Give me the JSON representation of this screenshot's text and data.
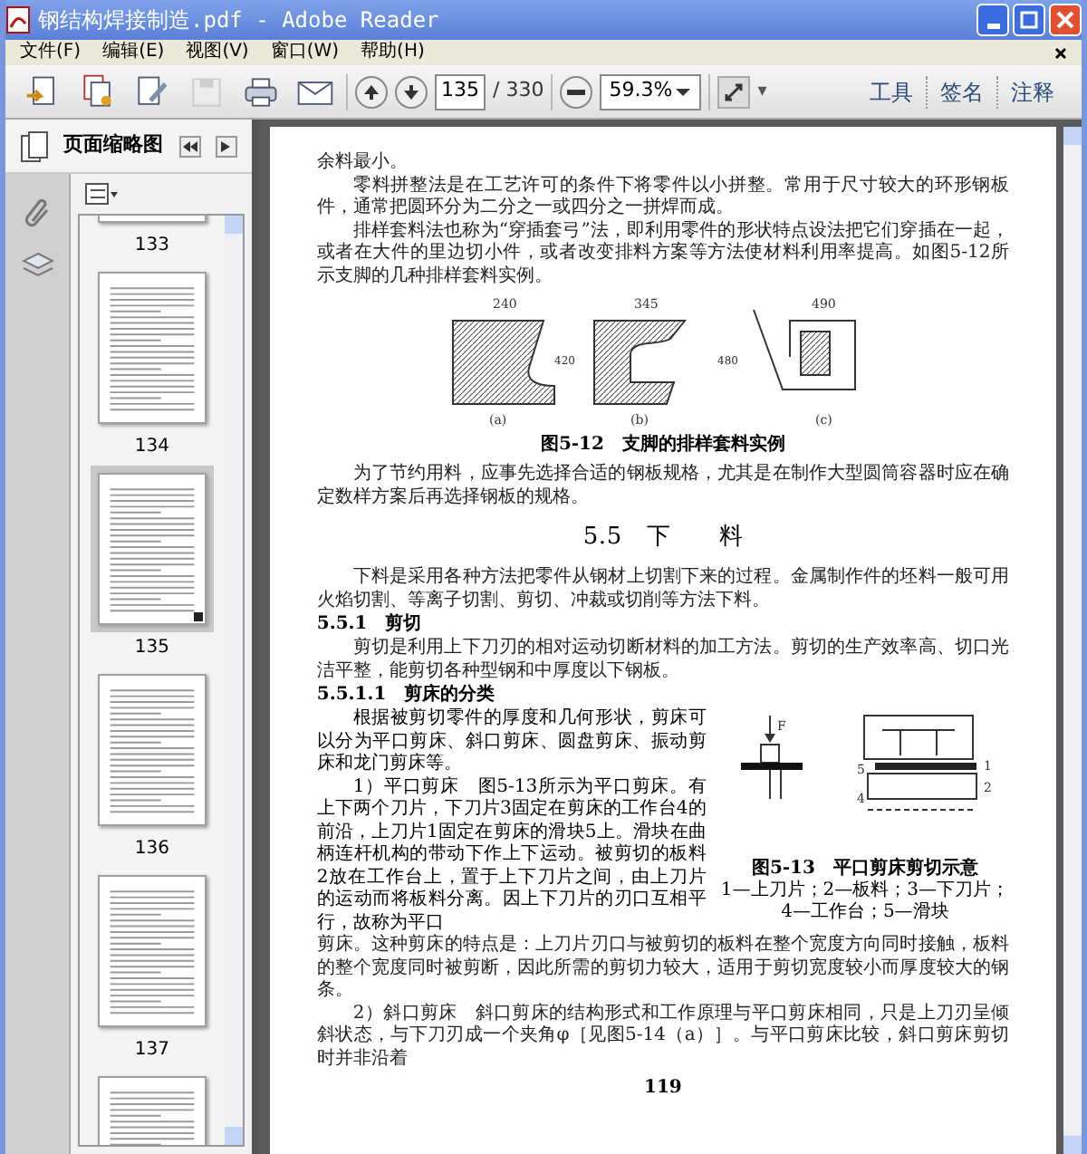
{
  "window": {
    "title": "钢结构焊接制造.pdf - Adobe Reader"
  },
  "menu": [
    {
      "label": "文件(F)"
    },
    {
      "label": "编辑(E)"
    },
    {
      "label": "视图(V)"
    },
    {
      "label": "窗口(W)"
    },
    {
      "label": "帮助(H)"
    }
  ],
  "toolbar": {
    "buttons": [
      {
        "kind": "create",
        "disabled": false
      },
      {
        "kind": "convert",
        "disabled": false
      },
      {
        "kind": "edit",
        "disabled": false
      },
      {
        "kind": "save",
        "disabled": true
      },
      {
        "kind": "print",
        "disabled": false
      },
      {
        "kind": "email",
        "disabled": false
      }
    ],
    "page_field": "135",
    "page_total": "/ 330",
    "zoom_field": "59.3%",
    "more": "▾",
    "panels": [
      {
        "label": "工具"
      },
      {
        "label": "签名"
      },
      {
        "label": "注释"
      }
    ]
  },
  "sidebar": {
    "title": "页面缩略图",
    "thumbnails": [
      {
        "label": "133",
        "selected": false
      },
      {
        "label": "134",
        "selected": false
      },
      {
        "label": "135",
        "selected": true
      },
      {
        "label": "136",
        "selected": false
      },
      {
        "label": "137",
        "selected": false
      },
      {
        "selected": false
      }
    ]
  },
  "document": {
    "blocks": [
      {
        "kind": "para",
        "text": "余料最小。",
        "indent": false
      },
      {
        "kind": "para",
        "text": "零料拼整法是在工艺许可的条件下将零件以小拼整。常用于尺寸较大的环形钢板件，通常把圆环分为二分之一或四分之一拼焊而成。",
        "indent": true
      },
      {
        "kind": "para",
        "text": "排样套料法也称为“穿插套弓”法，即利用零件的形状特点设法把它们穿插在一起，或者在大件的里边切小件，或者改变排料方案等方法使材料利用率提高。如图5-12所示支脚的几种排样套料实例。",
        "indent": true
      },
      {
        "kind": "figure",
        "dims": [
          "240",
          "345",
          "490"
        ],
        "heights": [
          "420",
          "480"
        ],
        "parts": [
          "(a)",
          "(b)",
          "(c)"
        ]
      },
      {
        "kind": "caption",
        "text": "图5-12　支脚的排样套料实例"
      },
      {
        "kind": "para",
        "text": "为了节约用料，应事先选择合适的钢板规格，尤其是在制作大型圆筒容器时应在确定数样方案后再选择钢板的规格。",
        "indent": true
      },
      {
        "kind": "section",
        "text": "5.5　下　　料"
      },
      {
        "kind": "para",
        "text": "下料是采用各种方法把零件从钢材上切割下来的过程。金属制作件的坯料一般可用火焰切割、等离子切割、剪切、冲裁或切削等方法下料。",
        "indent": true
      },
      {
        "kind": "subsection",
        "text": "5.5.1　剪切"
      },
      {
        "kind": "para",
        "text": "剪切是利用上下刀刃的相对运动切断材料的加工方法。剪切的生产效率高、切口光洁平整，能剪切各种型钢和中厚度以下钢板。",
        "indent": true
      },
      {
        "kind": "subsection",
        "text": "5.5.1.1　剪床的分类"
      },
      {
        "kind": "float",
        "paras": [
          "根据被剪切零件的厚度和几何形状，剪床可以分为平口剪床、斜口剪床、圆盘剪床、振动剪床和龙门剪床等。",
          "1）平口剪床　图5-13所示为平口剪床。有上下两个刀片，下刀片3固定在剪床的工作台4的前沿，上刀片1固定在剪床的滑块5上。滑块在曲柄连杆机构的带动下作上下运动。被剪切的板料2放在工作台上，置于上下刀片之间，由上刀片的运动而将板料分离。因上下刀片的刃口互相平行，故称为平口"
        ],
        "labels": [
          "F",
          "5",
          "1",
          "2",
          "4"
        ],
        "caption": "图5-13　平口剪床剪切示意",
        "legend": [
          "1—上刀片；2—板料；3—下刀片；",
          "4—工作台；5—滑块"
        ]
      },
      {
        "kind": "para",
        "text": "剪床。这种剪床的特点是：上刀片刃口与被剪切的板料在整个宽度方向同时接触，板料的整个宽度同时被剪断，因此所需的剪切力较大，适用于剪切宽度较小而厚度较大的钢条。",
        "indent": false
      },
      {
        "kind": "para",
        "text": "2）斜口剪床　斜口剪床的结构形式和工作原理与平口剪床相同，只是上刀刃呈倾斜状态，与下刀刃成一个夹角φ［见图5-14（a）］。与平口剪床比较，斜口剪床剪切时并非沿着",
        "indent": true
      },
      {
        "kind": "page_number",
        "text": "119"
      }
    ]
  }
}
